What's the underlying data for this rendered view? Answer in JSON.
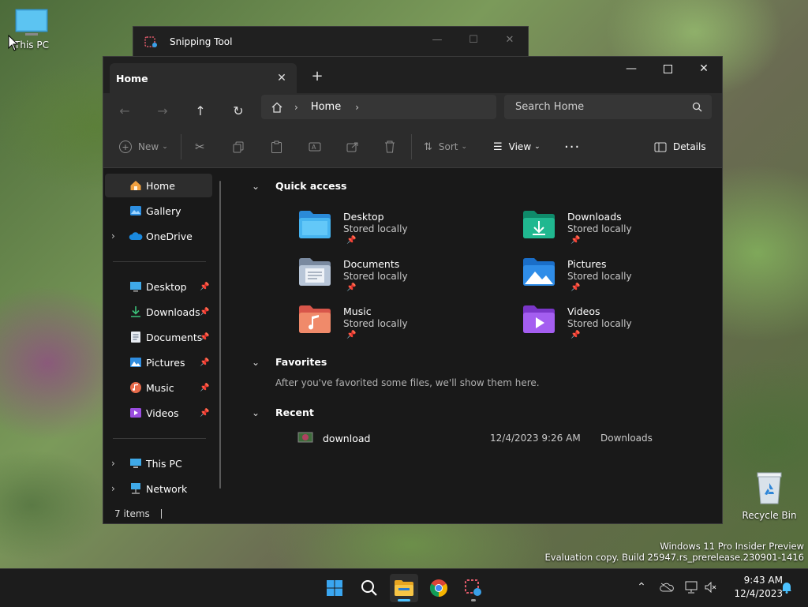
{
  "desktop": {
    "this_pc_label": "This PC",
    "recycle_bin_label": "Recycle Bin",
    "watermark_line1": "Windows 11 Pro Insider Preview",
    "watermark_line2": "Evaluation copy. Build 25947.rs_prerelease.230901-1416"
  },
  "snipping_tool": {
    "title": "Snipping Tool"
  },
  "explorer": {
    "tab_title": "Home",
    "address": {
      "home_icon": "home-icon",
      "crumb": "Home"
    },
    "search": {
      "placeholder": "Search Home"
    },
    "commands": {
      "new": "New",
      "sort": "Sort",
      "view": "View",
      "details": "Details"
    },
    "sidebar": {
      "top": [
        {
          "label": "Home",
          "icon": "home-icon"
        },
        {
          "label": "Gallery",
          "icon": "gallery-icon"
        },
        {
          "label": "OneDrive",
          "icon": "onedrive-icon"
        }
      ],
      "pinned": [
        {
          "label": "Desktop",
          "icon": "desktop-folder-icon"
        },
        {
          "label": "Downloads",
          "icon": "downloads-icon"
        },
        {
          "label": "Documents",
          "icon": "documents-icon"
        },
        {
          "label": "Pictures",
          "icon": "pictures-icon"
        },
        {
          "label": "Music",
          "icon": "music-icon"
        },
        {
          "label": "Videos",
          "icon": "videos-icon"
        }
      ],
      "bottom": [
        {
          "label": "This PC",
          "icon": "this-pc-icon"
        },
        {
          "label": "Network",
          "icon": "network-icon"
        }
      ]
    },
    "quick_access": {
      "title": "Quick access",
      "items": [
        {
          "name": "Desktop",
          "status": "Stored locally"
        },
        {
          "name": "Downloads",
          "status": "Stored locally"
        },
        {
          "name": "Documents",
          "status": "Stored locally"
        },
        {
          "name": "Pictures",
          "status": "Stored locally"
        },
        {
          "name": "Music",
          "status": "Stored locally"
        },
        {
          "name": "Videos",
          "status": "Stored locally"
        }
      ]
    },
    "favorites": {
      "title": "Favorites",
      "empty_text": "After you've favorited some files, we'll show them here."
    },
    "recent": {
      "title": "Recent",
      "items": [
        {
          "name": "download",
          "date": "12/4/2023 9:26 AM",
          "location": "Downloads"
        }
      ]
    },
    "status": {
      "count": "7 items"
    }
  },
  "taskbar": {
    "time": "9:43 AM",
    "date": "12/4/2023"
  },
  "colors": {
    "accent": "#4cc2ff",
    "window_bg": "#191919",
    "toolbar_bg": "#2c2c2c"
  }
}
